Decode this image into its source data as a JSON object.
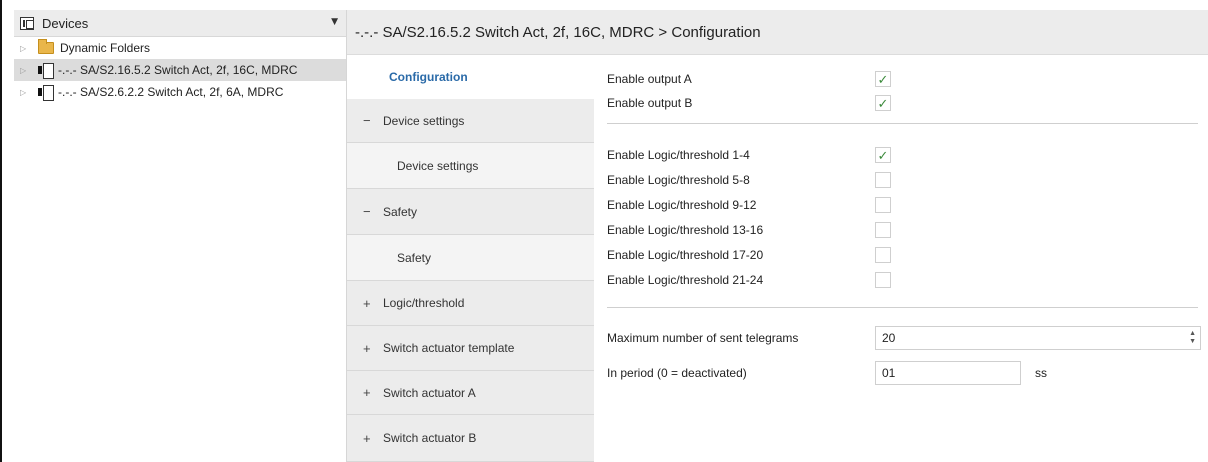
{
  "tree": {
    "header_title": "Devices",
    "header_caret": "▼",
    "items": [
      {
        "label": "Dynamic Folders"
      },
      {
        "label": "-.-.- SA/S2.16.5.2 Switch Act, 2f, 16C, MDRC"
      },
      {
        "label": "-.-.- SA/S2.6.2.2 Switch Act, 2f, 6A, MDRC"
      }
    ]
  },
  "main": {
    "title": "-.-.- SA/S2.16.5.2 Switch Act, 2f, 16C, MDRC > Configuration"
  },
  "nav": {
    "items": [
      {
        "label": "Configuration",
        "sym": ""
      },
      {
        "label": "Device settings",
        "sym": "−"
      },
      {
        "label": "Device settings",
        "sym": ""
      },
      {
        "label": "Safety",
        "sym": "−"
      },
      {
        "label": "Safety",
        "sym": ""
      },
      {
        "label": "Logic/threshold",
        "sym": "+"
      },
      {
        "label": "Switch actuator template",
        "sym": "+"
      },
      {
        "label": "Switch actuator A",
        "sym": "+"
      },
      {
        "label": "Switch actuator B",
        "sym": "+"
      }
    ]
  },
  "config": {
    "rows": [
      {
        "label": "Enable output A",
        "checked": true,
        "mark": "✓"
      },
      {
        "label": "Enable output B",
        "checked": true,
        "mark": "✓"
      },
      {
        "label": "Enable Logic/threshold 1-4",
        "checked": true,
        "mark": "✓"
      },
      {
        "label": "Enable Logic/threshold 5-8",
        "checked": false,
        "mark": ""
      },
      {
        "label": "Enable Logic/threshold 9-12",
        "checked": false,
        "mark": ""
      },
      {
        "label": "Enable Logic/threshold 13-16",
        "checked": false,
        "mark": ""
      },
      {
        "label": "Enable Logic/threshold 17-20",
        "checked": false,
        "mark": ""
      },
      {
        "label": "Enable Logic/threshold 21-24",
        "checked": false,
        "mark": ""
      }
    ],
    "max_telegrams_label": "Maximum number of sent telegrams",
    "max_telegrams_value": "20",
    "period_label": "In period (0 = deactivated)",
    "period_value": "01",
    "period_unit": "ss"
  },
  "colors": {
    "accent": "#2a6aa8",
    "check": "#3b8a3b"
  }
}
